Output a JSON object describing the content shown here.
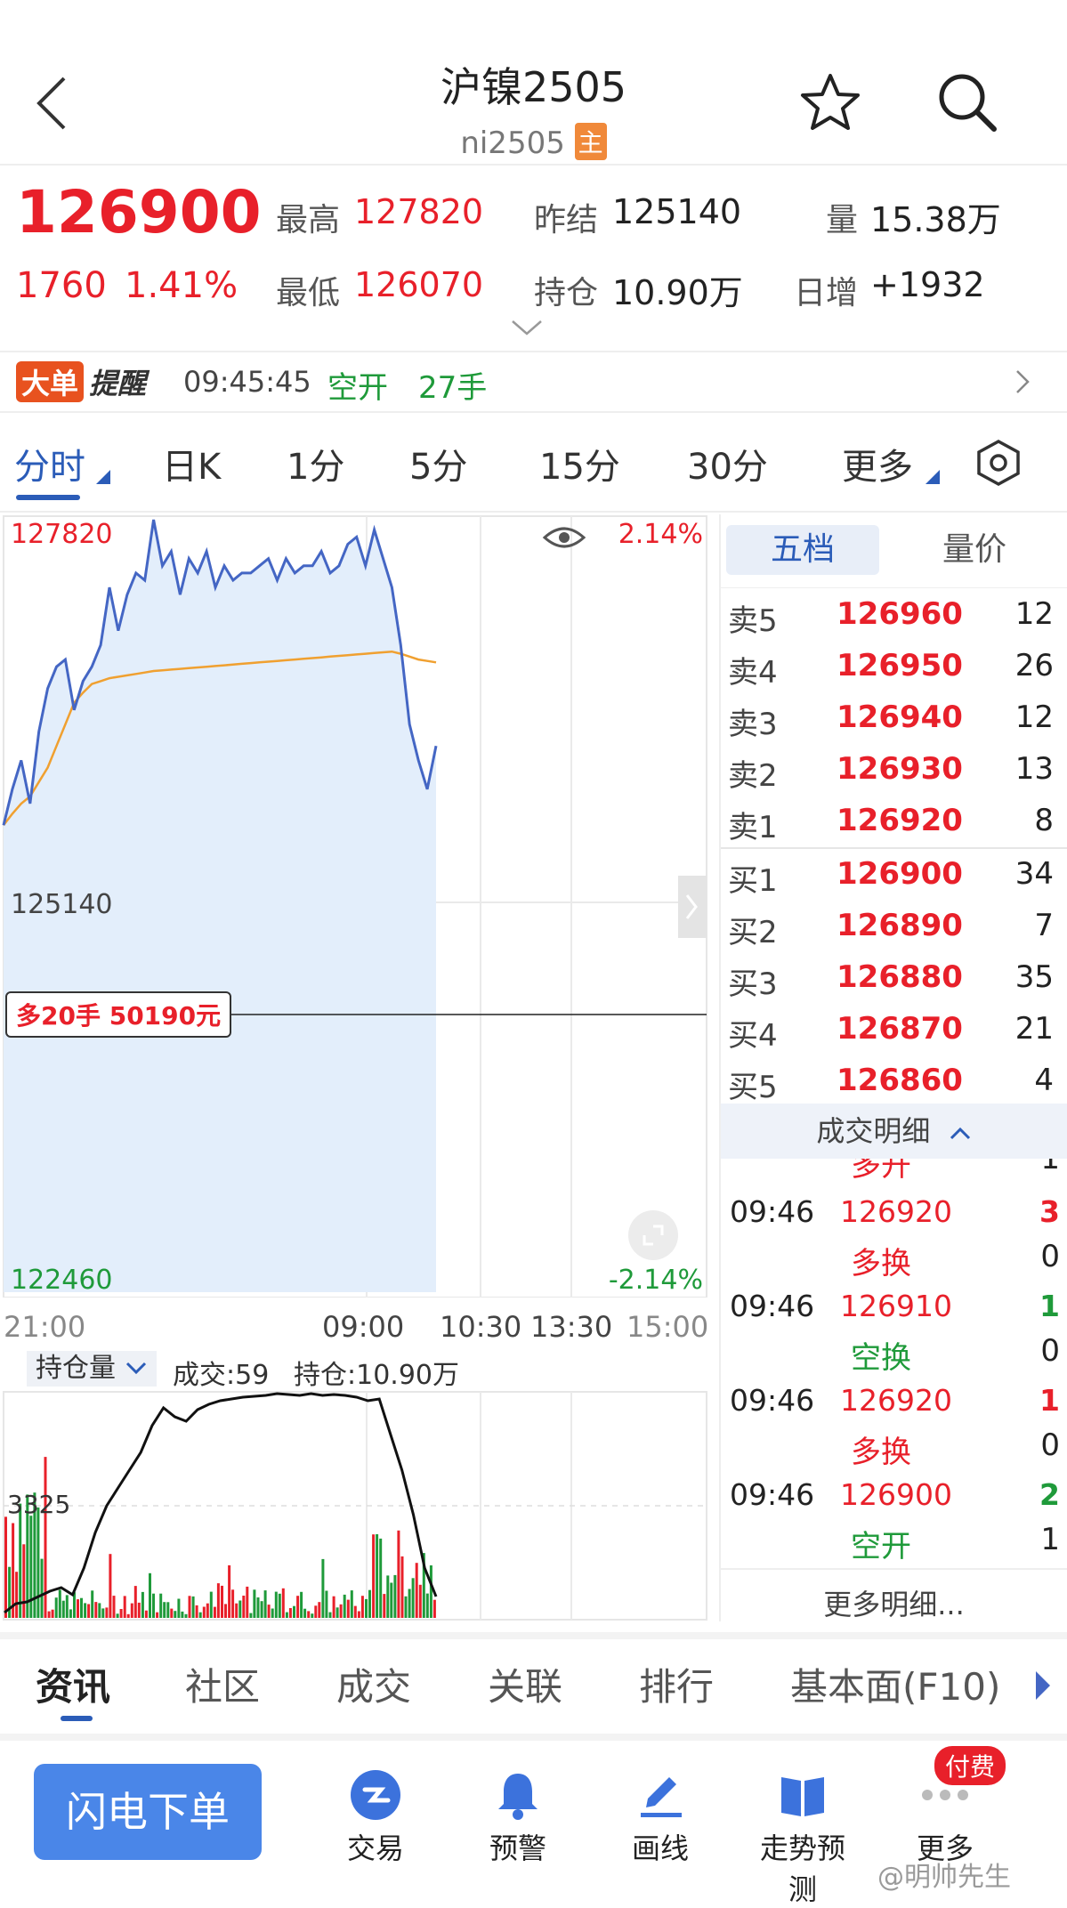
{
  "header": {
    "title": "沪镍2505",
    "code": "ni2505",
    "main_badge": "主"
  },
  "quote": {
    "last_price": "126900",
    "change": "1760",
    "change_pct": "1.41%",
    "high_label": "最高",
    "high": "127820",
    "low_label": "最低",
    "low": "126070",
    "prev_settle_label": "昨结",
    "prev_settle": "125140",
    "open_interest_label": "持仓",
    "open_interest": "10.90万",
    "volume_label": "量",
    "volume": "15.38万",
    "daily_increase_label": "日增",
    "daily_increase": "+1932"
  },
  "alert": {
    "badge_a": "大单",
    "badge_b": "提醒",
    "time": "09:45:45",
    "action": "空开",
    "qty": "27手"
  },
  "period_tabs": [
    "分时",
    "日K",
    "1分",
    "5分",
    "15分",
    "30分",
    "更多"
  ],
  "chart": {
    "top_price": "127820",
    "mid_price": "125140",
    "bottom_price": "122460",
    "top_pct": "2.14%",
    "bottom_pct": "-2.14%",
    "position_tag": "多20手 50190元",
    "time_labels": [
      "21:00",
      "09:00",
      "10:30",
      "13:30",
      "15:00"
    ],
    "sub_selector": "持仓量",
    "sub_volume": "成交:59",
    "sub_oi": "持仓:10.90万",
    "sub_axis_label": "3325",
    "colors": {
      "price_line": "#4466c4",
      "avg_line": "#f0a030",
      "fill": "#e3eefb",
      "up": "#e8202a",
      "down": "#1f9a3a"
    }
  },
  "chart_data": {
    "type": "line",
    "x_start": "21:00",
    "y_range": [
      122460,
      127820
    ],
    "series": [
      {
        "values": [
          125700,
          125950,
          126150,
          125850,
          126350,
          126650,
          126800,
          126850,
          126500,
          126700,
          126800,
          126950,
          127350,
          127050,
          127300,
          127450,
          127400,
          127820,
          127500,
          127600,
          127300,
          127550,
          127450,
          127600,
          127350,
          127500,
          127400,
          127450,
          127450,
          127500,
          127550,
          127400,
          127550,
          127450,
          127500,
          127500,
          127600,
          127450,
          127500,
          127650,
          127700,
          127500,
          127750,
          127550,
          127350,
          126950,
          126400,
          126150,
          125950,
          126250
        ]
      },
      {
        "values": [
          125700,
          125780,
          125850,
          125900,
          126000,
          126100,
          126250,
          126400,
          126550,
          126620,
          126680,
          126700,
          126720,
          126730,
          126740,
          126750,
          126760,
          126770,
          126775,
          126780,
          126785,
          126790,
          126795,
          126800,
          126805,
          126810,
          126815,
          126820,
          126825,
          126830,
          126835,
          126840,
          126845,
          126850,
          126855,
          126860,
          126865,
          126870,
          126875,
          126880,
          126885,
          126890,
          126895,
          126900,
          126905,
          126890,
          126870,
          126850,
          126840,
          126830
        ]
      }
    ]
  },
  "orderbook": {
    "tab_active": "五档",
    "tab_other": "量价",
    "asks": [
      {
        "label": "卖5",
        "price": "126960",
        "vol": "12"
      },
      {
        "label": "卖4",
        "price": "126950",
        "vol": "26"
      },
      {
        "label": "卖3",
        "price": "126940",
        "vol": "12"
      },
      {
        "label": "卖2",
        "price": "126930",
        "vol": "13"
      },
      {
        "label": "卖1",
        "price": "126920",
        "vol": "8"
      }
    ],
    "bids": [
      {
        "label": "买1",
        "price": "126900",
        "vol": "34"
      },
      {
        "label": "买2",
        "price": "126890",
        "vol": "7"
      },
      {
        "label": "买3",
        "price": "126880",
        "vol": "35"
      },
      {
        "label": "买4",
        "price": "126870",
        "vol": "21"
      },
      {
        "label": "买5",
        "price": "126860",
        "vol": "4"
      }
    ]
  },
  "trades": {
    "header": "成交明细",
    "partial_type": "多开",
    "partial_change": "1",
    "rows": [
      {
        "time": "09:46",
        "price": "126920",
        "qty": "3",
        "type": "多换",
        "change": "0",
        "color": "red"
      },
      {
        "time": "09:46",
        "price": "126910",
        "qty": "1",
        "type": "空换",
        "change": "0",
        "color": "green"
      },
      {
        "time": "09:46",
        "price": "126920",
        "qty": "1",
        "type": "多换",
        "change": "0",
        "color": "red"
      },
      {
        "time": "09:46",
        "price": "126900",
        "qty": "2",
        "type": "空开",
        "change": "1",
        "color": "green"
      }
    ],
    "more": "更多明细..."
  },
  "bottom_tabs": [
    "资讯",
    "社区",
    "成交",
    "关联",
    "排行",
    "基本面(F10)"
  ],
  "toolbar": {
    "order_button": "闪电下单",
    "items": [
      "交易",
      "预警",
      "画线",
      "走势预测",
      "更多"
    ],
    "paid_badge": "付费"
  },
  "watermark": "@明帅先生"
}
